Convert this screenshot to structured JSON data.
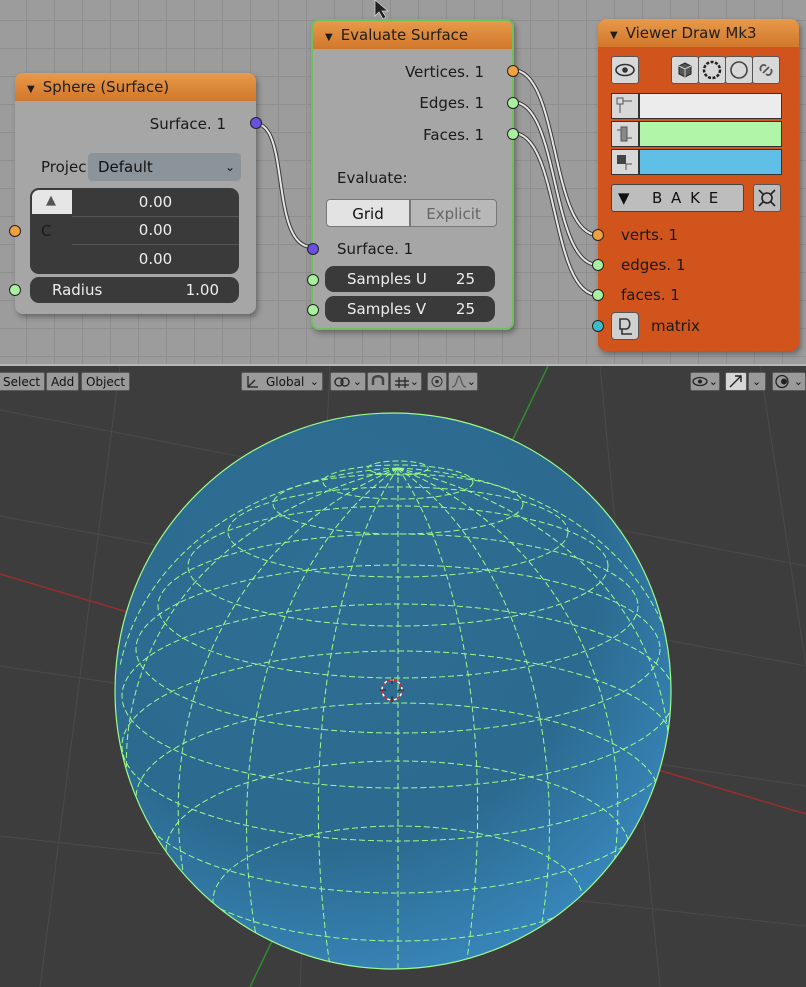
{
  "sphere_node": {
    "title": "Sphere (Surface)",
    "output_surface": "Surface. 1",
    "projection_label": "Projec",
    "projection_value": "Default",
    "center_label": "C",
    "center_values": [
      "0.00",
      "0.00",
      "0.00"
    ],
    "radius_label": "Radius",
    "radius_value": "1.00"
  },
  "evaluate_node": {
    "title": "Evaluate Surface",
    "outputs": [
      "Vertices. 1",
      "Edges. 1",
      "Faces. 1"
    ],
    "evaluate_label": "Evaluate:",
    "modes": [
      "Grid",
      "Explicit"
    ],
    "active_mode": "Grid",
    "input_surface": "Surface. 1",
    "samples_u_label": "Samples U",
    "samples_u_value": "25",
    "samples_v_label": "Samples V",
    "samples_v_value": "25"
  },
  "viewer_node": {
    "title": "Viewer Draw Mk3",
    "bake_label": "B A K E",
    "inputs": [
      "verts. 1",
      "edges. 1",
      "faces. 1",
      "matrix"
    ],
    "vertex_color": "#ececec",
    "edge_color": "#b0f5a8",
    "face_color": "#5fbfe6"
  },
  "viewport_header": {
    "menus": [
      "Select",
      "Add",
      "Object"
    ],
    "orientation": "Global"
  },
  "colors": {
    "node_header": "#e08a3c",
    "viewer_body": "#d0541c",
    "socket_vertices": "#f0a040",
    "socket_edges": "#a8f0a0",
    "socket_surface": "#6a4fe0",
    "socket_matrix": "#3cbcc8",
    "axis_x": "#b03030",
    "axis_y": "#3a9a3a"
  }
}
